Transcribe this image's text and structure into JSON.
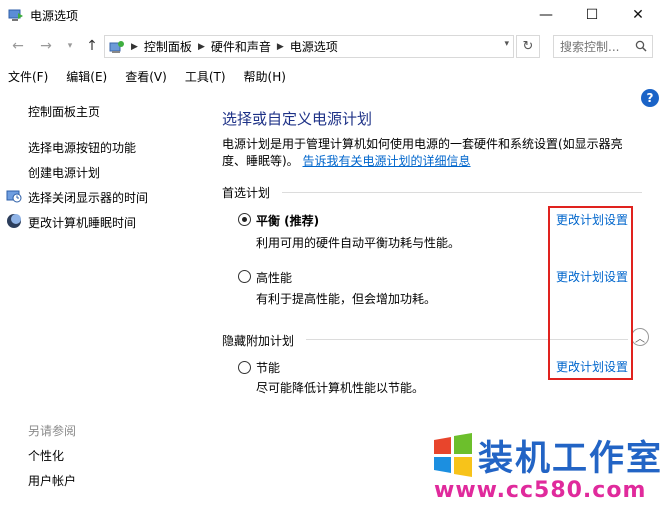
{
  "window": {
    "title": "电源选项",
    "controls": {
      "minimize": "—",
      "maximize": "☐",
      "close": "✕"
    }
  },
  "address": {
    "crumbs": [
      "控制面板",
      "硬件和声音",
      "电源选项"
    ],
    "search_placeholder": "搜索控制..."
  },
  "menu": [
    "文件(F)",
    "编辑(E)",
    "查看(V)",
    "工具(T)",
    "帮助(H)"
  ],
  "help": "?",
  "sidebar": {
    "home": "控制面板主页",
    "items": [
      {
        "label": "选择电源按钮的功能",
        "icon": ""
      },
      {
        "label": "创建电源计划",
        "icon": ""
      },
      {
        "label": "选择关闭显示器的时间",
        "icon": "monitor-clock-icon"
      },
      {
        "label": "更改计算机睡眠时间",
        "icon": "moon-icon"
      }
    ],
    "see_also": "另请参阅",
    "see_also_items": [
      "个性化",
      "用户帐户"
    ]
  },
  "main": {
    "title": "选择或自定义电源计划",
    "desc": "电源计划是用于管理计算机如何使用电源的一套硬件和系统设置(如显示器亮度、睡眠等)。",
    "desc_link": "告诉我有关电源计划的详细信息",
    "preferred_header": "首选计划",
    "hidden_header": "隐藏附加计划",
    "plans": [
      {
        "name": "平衡 (推荐)",
        "desc": "利用可用的硬件自动平衡功耗与性能。",
        "link": "更改计划设置",
        "selected": true
      },
      {
        "name": "高性能",
        "desc": "有利于提高性能，但会增加功耗。",
        "link": "更改计划设置",
        "selected": false
      },
      {
        "name": "节能",
        "desc": "尽可能降低计算机性能以节能。",
        "link": "更改计划设置",
        "selected": false
      }
    ]
  },
  "watermark": {
    "text": "装机工作室",
    "url": "www.cc580.com"
  },
  "colors": {
    "link": "#0066cc",
    "title": "#1e3287",
    "highlight_box": "#e0221e",
    "watermark_blue": "#2264c5",
    "watermark_pink": "#e02a9c"
  }
}
